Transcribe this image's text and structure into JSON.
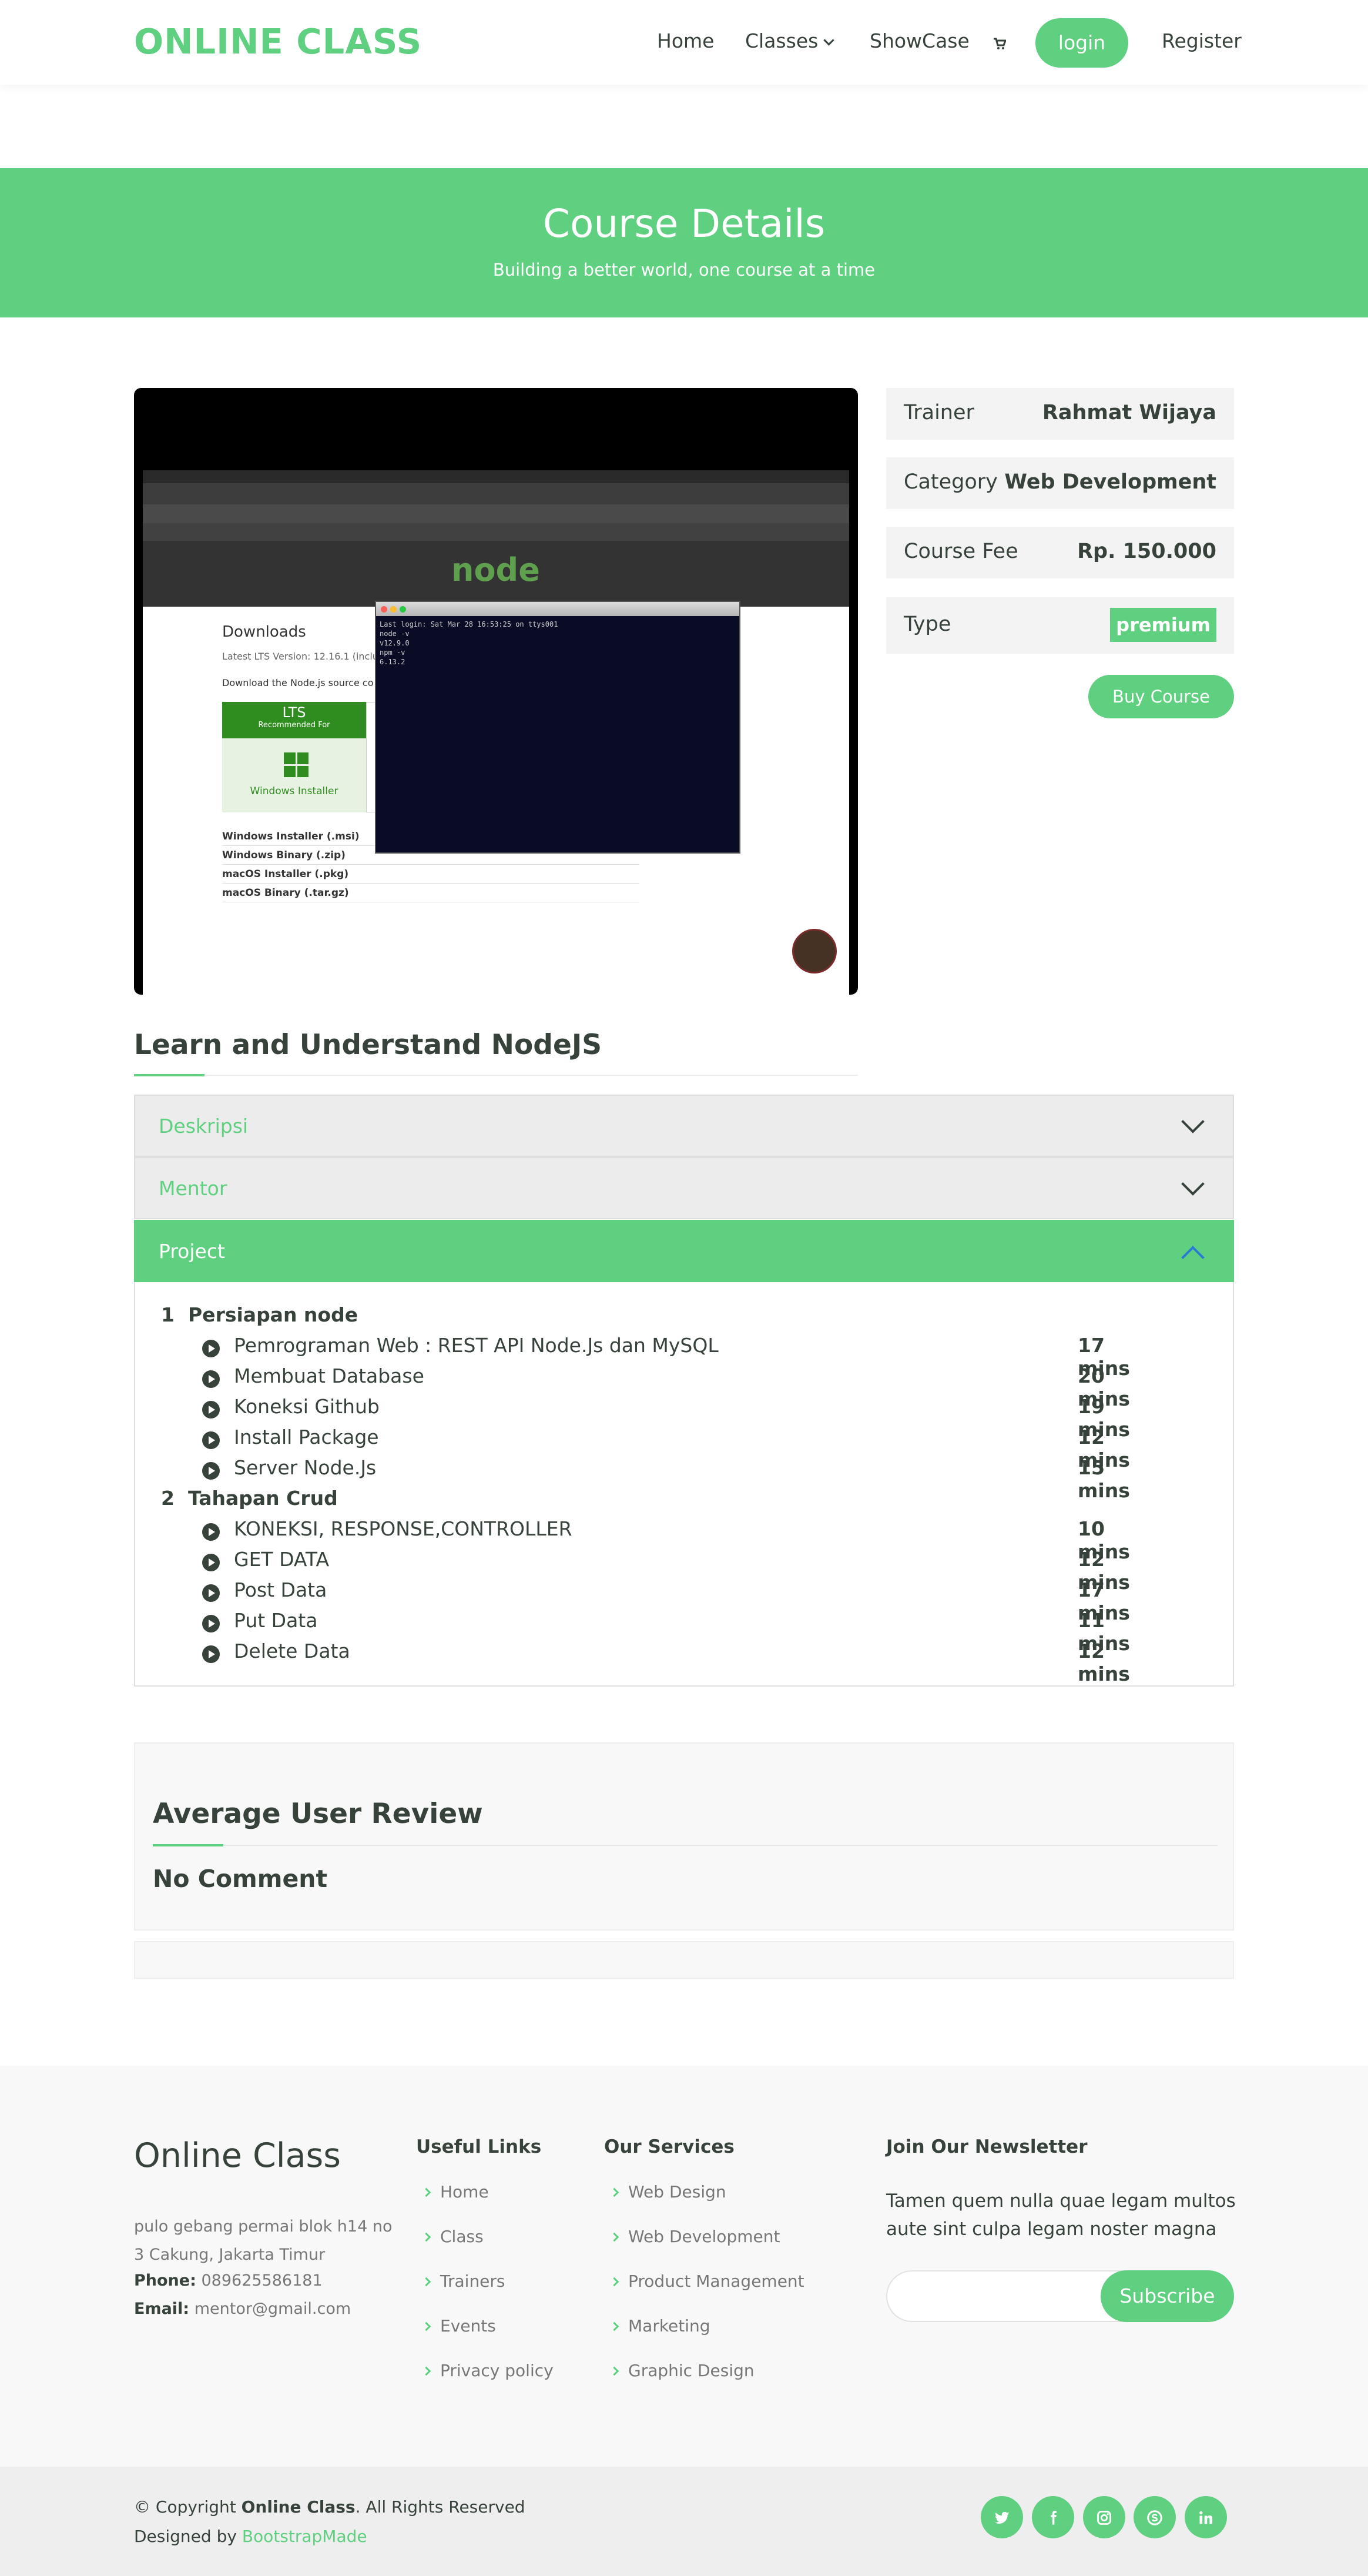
{
  "header": {
    "logo": "ONLINE CLASS",
    "nav": {
      "home": "Home",
      "classes": "Classes",
      "showcase": "ShowCase",
      "cart_icon": "cart-icon",
      "login": "login",
      "register": "Register"
    }
  },
  "hero": {
    "title": "Course Details",
    "subtitle": "Building a better world, one course at a time"
  },
  "video_screen": {
    "node_logo": "node",
    "downloads_title": "Downloads",
    "lts_version": "Latest LTS Version: 12.16.1 (inclu",
    "source_text": "Download the Node.js source co",
    "lts_box_title": "LTS",
    "lts_box_sub": "Recommended For",
    "windows_installer": "Windows Installer",
    "rows": [
      "Windows Installer (.msi)",
      "Windows Binary (.zip)",
      "macOS Installer (.pkg)",
      "macOS Binary (.tar.gz)"
    ],
    "terminal_lines": [
      "Last login: Sat Mar 28 16:53:25 on ttys001",
      "node -v",
      "v12.9.0",
      "npm -v",
      "6.13.2"
    ]
  },
  "course_info": {
    "trainer_label": "Trainer",
    "trainer_value": "Rahmat Wijaya",
    "category_label": "Category",
    "category_value": "Web Development",
    "fee_label": "Course Fee",
    "fee_value": "Rp. 150.000",
    "type_label": "Type",
    "type_value": "premium",
    "buy_button": "Buy Course"
  },
  "course": {
    "title": "Learn and Understand NodeJS"
  },
  "accordion": {
    "deskripsi": "Deskripsi",
    "mentor": "Mentor",
    "project": "Project"
  },
  "project": {
    "sections": [
      {
        "num": "1",
        "title": "Persiapan node",
        "lessons": [
          {
            "title": "Pemrograman Web : REST API Node.Js dan MySQL",
            "duration": "17 mins"
          },
          {
            "title": "Membuat Database",
            "duration": "20 mins"
          },
          {
            "title": "Koneksi Github",
            "duration": "19 mins"
          },
          {
            "title": "Install Package",
            "duration": "12 mins"
          },
          {
            "title": "Server Node.Js",
            "duration": "15 mins"
          }
        ]
      },
      {
        "num": "2",
        "title": "Tahapan Crud",
        "lessons": [
          {
            "title": "KONEKSI, RESPONSE,CONTROLLER",
            "duration": "10 mins"
          },
          {
            "title": "GET DATA",
            "duration": "12 mins"
          },
          {
            "title": "Post Data",
            "duration": "17 mins"
          },
          {
            "title": "Put Data",
            "duration": "11 mins"
          },
          {
            "title": "Delete Data",
            "duration": "12 mins"
          }
        ]
      }
    ]
  },
  "review": {
    "title": "Average User Review",
    "empty": "No Comment"
  },
  "footer": {
    "brand": "Online Class",
    "address": "pulo gebang permai blok h14 no 3 Cakung, Jakarta Timur",
    "phone_label": "Phone:",
    "phone": "089625586181",
    "email_label": "Email:",
    "email": "mentor@gmail.com",
    "useful_title": "Useful Links",
    "useful_links": [
      "Home",
      "Class",
      "Trainers",
      "Events",
      "Privacy policy"
    ],
    "services_title": "Our Services",
    "services": [
      "Web Design",
      "Web Development",
      "Product Management",
      "Marketing",
      "Graphic Design"
    ],
    "newsletter_title": "Join Our Newsletter",
    "newsletter_text": "Tamen quem nulla quae legam multos aute sint culpa legam noster magna",
    "newsletter_input_placeholder": "",
    "subscribe": "Subscribe"
  },
  "bottom": {
    "copyright_prefix": "© Copyright ",
    "copyright_brand": "Online Class",
    "copyright_suffix": ". All Rights Reserved",
    "designed_by": "Designed by ",
    "designer": "BootstrapMade",
    "social_icons": [
      "twitter-icon",
      "facebook-icon",
      "instagram-icon",
      "skype-icon",
      "linkedin-icon"
    ]
  },
  "colors": {
    "accent": "#5fcf80",
    "text": "#37423b"
  }
}
